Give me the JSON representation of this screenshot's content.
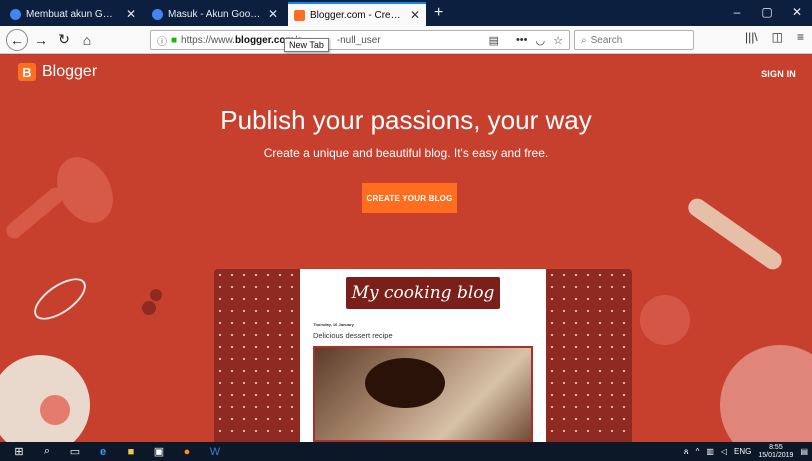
{
  "browser": {
    "tabs": [
      {
        "title": "Membuat akun Gmail - Bantua",
        "icon_color": "#4285f4",
        "active": false
      },
      {
        "title": "Masuk - Akun Google",
        "icon_color": "#4285f4",
        "active": false
      },
      {
        "title": "Blogger.com - Create a unique",
        "icon_color": "#ff6f21",
        "active": true
      }
    ],
    "newtab_symbol": "+",
    "url_prefix": "https://www.",
    "url_domain": "blogger.com",
    "url_path": "/a",
    "url_tail": "-null_user",
    "tooltip": "New Tab",
    "search_placeholder": "Search",
    "window_controls": [
      "–",
      "▢",
      "✕"
    ]
  },
  "blogger": {
    "brand": "Blogger",
    "logo_letter": "B",
    "signin": "SIGN IN",
    "headline": "Publish your passions, your way",
    "subline": "Create a unique and beautiful blog. It's easy and free.",
    "cta": "CREATE YOUR BLOG",
    "accent_color": "#ff6d1f",
    "background_color": "#c7402e"
  },
  "mock_blog": {
    "title": "My cooking blog",
    "date": "Thursday, 16 January",
    "post_title": "Delicious dessert recipe"
  },
  "taskbar": {
    "lang": "ENG",
    "time": "8:55",
    "date": "15/01/2019"
  }
}
